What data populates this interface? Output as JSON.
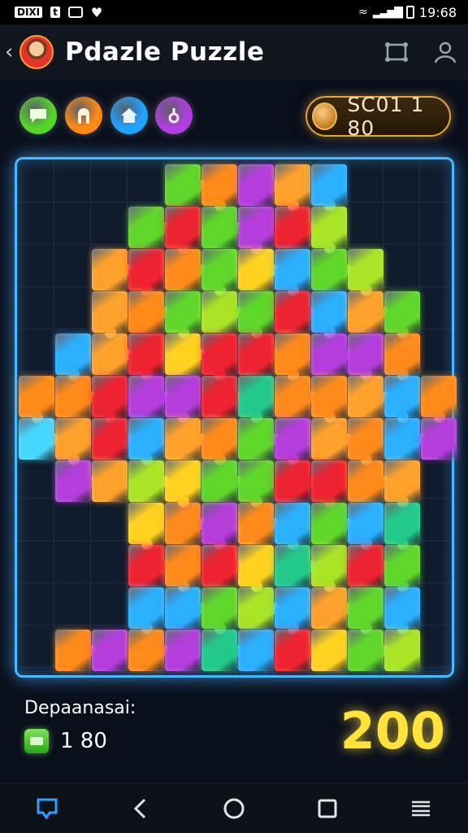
{
  "status": {
    "chip1": "DIXI",
    "chip2": "t",
    "time": "19:68"
  },
  "header": {
    "title": "Pdazle Puzzle"
  },
  "score": {
    "label": "SC01 1 80"
  },
  "badges": [
    {
      "name": "chat-badge",
      "color": "#55d42a",
      "icon": "speech-bubble-icon"
    },
    {
      "name": "shop-badge",
      "color": "#ff8a12",
      "icon": "arch-icon"
    },
    {
      "name": "home-badge",
      "color": "#1fa3ff",
      "icon": "house-icon"
    },
    {
      "name": "hint-badge",
      "color": "#b13ee0",
      "icon": "key-icon"
    }
  ],
  "footer": {
    "label": "Depaanasai:",
    "count": "1 80",
    "points": "200"
  },
  "palette": {
    "G": "#5fd62a",
    "O": "#ff8a1a",
    "P": "#b43ddc",
    "A": "#ffa12a",
    "B": "#2ab0ff",
    "R": "#ee2230",
    "L": "#a9e426",
    "Y": "#ffd21f",
    "T": "#22c98a",
    "C": "#45d7ff"
  },
  "board": {
    "rows": [
      ". . . . G O P A B . . .",
      ". . . G R G P R L . . .",
      ". . A R O G Y B G L . .",
      ". . A O G L G R B A G .",
      ". B A R Y R R O P P O .",
      "O O R P P R T O O A B O",
      "C A R B A O G P A O B P",
      ". P A L Y G G R R O A .",
      ". . . Y O P O B G B T .",
      ". . . R O R Y T L R G .",
      ". . . B B G L B A G B .",
      ". O P O P T B R Y G L ."
    ]
  }
}
